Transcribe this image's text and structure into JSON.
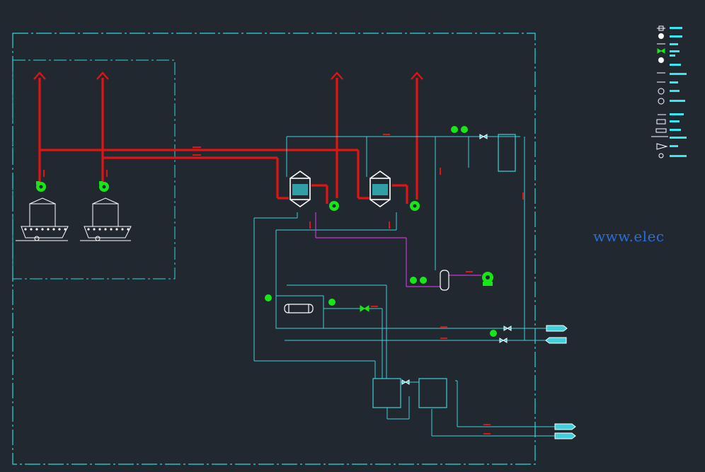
{
  "watermark": "www.elec",
  "colors": {
    "background": "#212830",
    "frame": "#2fd6dd",
    "process_line": "#3fd0dc",
    "exhaust_duct": "#e01414",
    "fan": "#19e619",
    "purge_line": "#c23ad6",
    "equipment": "#ffffff",
    "watermark": "#2a6fd6"
  },
  "icons": [
    "exhaust-fan-icon",
    "adsorber-vessel-icon",
    "condenser-icon",
    "storage-tank-icon",
    "valve-icon",
    "pressure-gauge-icon",
    "arrow-up-icon",
    "conveyor-icon",
    "legend-symbol-icon"
  ],
  "streams": {
    "inlet_1": "",
    "inlet_2": "",
    "outlet_1": "",
    "outlet_2": ""
  }
}
